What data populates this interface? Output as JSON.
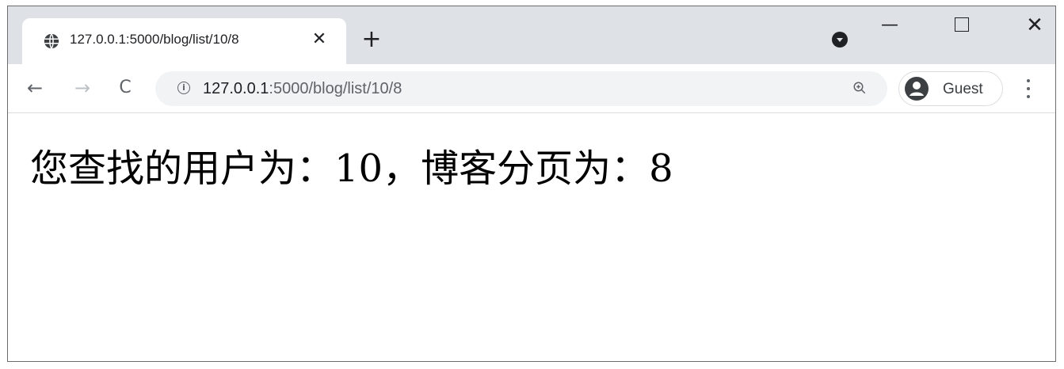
{
  "tab": {
    "title": "127.0.0.1:5000/blog/list/10/8",
    "favicon": "globe-icon",
    "close_glyph": "✕"
  },
  "new_tab_glyph": "+",
  "window_controls": {
    "minimize_glyph": "—",
    "close_glyph": "✕"
  },
  "toolbar": {
    "back_glyph": "←",
    "forward_glyph": "→",
    "reload_glyph": "C"
  },
  "omnibox": {
    "info_glyph": "i",
    "url_host": "127.0.0.1",
    "url_rest": ":5000/blog/list/10/8"
  },
  "profile": {
    "label": "Guest"
  },
  "content": {
    "text": "您查找的用户为：10，博客分页为：8"
  },
  "colors": {
    "titlebar": "#dee1e6",
    "omnibox": "#f1f3f4",
    "text": "#202124",
    "icon": "#5f6368"
  }
}
